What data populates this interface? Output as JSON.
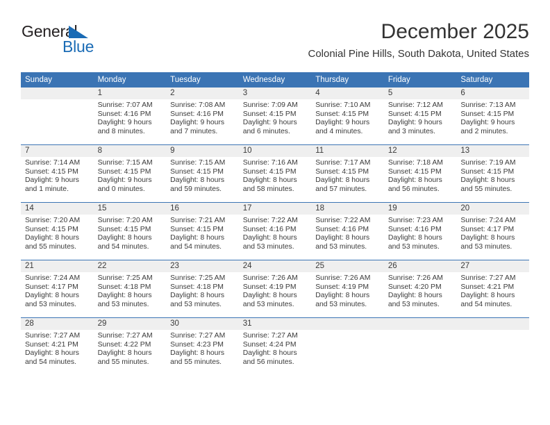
{
  "brand": {
    "name_top": "General",
    "name_bottom": "Blue",
    "accent_color": "#1a6bb5"
  },
  "header": {
    "title": "December 2025",
    "subtitle": "Colonial Pine Hills, South Dakota, United States",
    "header_bg_color": "#3b74b4",
    "daynum_bg_color": "#efefef"
  },
  "calendar": {
    "weekday_headers": [
      "Sunday",
      "Monday",
      "Tuesday",
      "Wednesday",
      "Thursday",
      "Friday",
      "Saturday"
    ],
    "weeks": [
      [
        {
          "day": "",
          "sunrise": "",
          "sunset": "",
          "daylight_line1": "",
          "daylight_line2": ""
        },
        {
          "day": "1",
          "sunrise": "Sunrise: 7:07 AM",
          "sunset": "Sunset: 4:16 PM",
          "daylight_line1": "Daylight: 9 hours",
          "daylight_line2": "and 8 minutes."
        },
        {
          "day": "2",
          "sunrise": "Sunrise: 7:08 AM",
          "sunset": "Sunset: 4:16 PM",
          "daylight_line1": "Daylight: 9 hours",
          "daylight_line2": "and 7 minutes."
        },
        {
          "day": "3",
          "sunrise": "Sunrise: 7:09 AM",
          "sunset": "Sunset: 4:15 PM",
          "daylight_line1": "Daylight: 9 hours",
          "daylight_line2": "and 6 minutes."
        },
        {
          "day": "4",
          "sunrise": "Sunrise: 7:10 AM",
          "sunset": "Sunset: 4:15 PM",
          "daylight_line1": "Daylight: 9 hours",
          "daylight_line2": "and 4 minutes."
        },
        {
          "day": "5",
          "sunrise": "Sunrise: 7:12 AM",
          "sunset": "Sunset: 4:15 PM",
          "daylight_line1": "Daylight: 9 hours",
          "daylight_line2": "and 3 minutes."
        },
        {
          "day": "6",
          "sunrise": "Sunrise: 7:13 AM",
          "sunset": "Sunset: 4:15 PM",
          "daylight_line1": "Daylight: 9 hours",
          "daylight_line2": "and 2 minutes."
        }
      ],
      [
        {
          "day": "7",
          "sunrise": "Sunrise: 7:14 AM",
          "sunset": "Sunset: 4:15 PM",
          "daylight_line1": "Daylight: 9 hours",
          "daylight_line2": "and 1 minute."
        },
        {
          "day": "8",
          "sunrise": "Sunrise: 7:15 AM",
          "sunset": "Sunset: 4:15 PM",
          "daylight_line1": "Daylight: 9 hours",
          "daylight_line2": "and 0 minutes."
        },
        {
          "day": "9",
          "sunrise": "Sunrise: 7:15 AM",
          "sunset": "Sunset: 4:15 PM",
          "daylight_line1": "Daylight: 8 hours",
          "daylight_line2": "and 59 minutes."
        },
        {
          "day": "10",
          "sunrise": "Sunrise: 7:16 AM",
          "sunset": "Sunset: 4:15 PM",
          "daylight_line1": "Daylight: 8 hours",
          "daylight_line2": "and 58 minutes."
        },
        {
          "day": "11",
          "sunrise": "Sunrise: 7:17 AM",
          "sunset": "Sunset: 4:15 PM",
          "daylight_line1": "Daylight: 8 hours",
          "daylight_line2": "and 57 minutes."
        },
        {
          "day": "12",
          "sunrise": "Sunrise: 7:18 AM",
          "sunset": "Sunset: 4:15 PM",
          "daylight_line1": "Daylight: 8 hours",
          "daylight_line2": "and 56 minutes."
        },
        {
          "day": "13",
          "sunrise": "Sunrise: 7:19 AM",
          "sunset": "Sunset: 4:15 PM",
          "daylight_line1": "Daylight: 8 hours",
          "daylight_line2": "and 55 minutes."
        }
      ],
      [
        {
          "day": "14",
          "sunrise": "Sunrise: 7:20 AM",
          "sunset": "Sunset: 4:15 PM",
          "daylight_line1": "Daylight: 8 hours",
          "daylight_line2": "and 55 minutes."
        },
        {
          "day": "15",
          "sunrise": "Sunrise: 7:20 AM",
          "sunset": "Sunset: 4:15 PM",
          "daylight_line1": "Daylight: 8 hours",
          "daylight_line2": "and 54 minutes."
        },
        {
          "day": "16",
          "sunrise": "Sunrise: 7:21 AM",
          "sunset": "Sunset: 4:15 PM",
          "daylight_line1": "Daylight: 8 hours",
          "daylight_line2": "and 54 minutes."
        },
        {
          "day": "17",
          "sunrise": "Sunrise: 7:22 AM",
          "sunset": "Sunset: 4:16 PM",
          "daylight_line1": "Daylight: 8 hours",
          "daylight_line2": "and 53 minutes."
        },
        {
          "day": "18",
          "sunrise": "Sunrise: 7:22 AM",
          "sunset": "Sunset: 4:16 PM",
          "daylight_line1": "Daylight: 8 hours",
          "daylight_line2": "and 53 minutes."
        },
        {
          "day": "19",
          "sunrise": "Sunrise: 7:23 AM",
          "sunset": "Sunset: 4:16 PM",
          "daylight_line1": "Daylight: 8 hours",
          "daylight_line2": "and 53 minutes."
        },
        {
          "day": "20",
          "sunrise": "Sunrise: 7:24 AM",
          "sunset": "Sunset: 4:17 PM",
          "daylight_line1": "Daylight: 8 hours",
          "daylight_line2": "and 53 minutes."
        }
      ],
      [
        {
          "day": "21",
          "sunrise": "Sunrise: 7:24 AM",
          "sunset": "Sunset: 4:17 PM",
          "daylight_line1": "Daylight: 8 hours",
          "daylight_line2": "and 53 minutes."
        },
        {
          "day": "22",
          "sunrise": "Sunrise: 7:25 AM",
          "sunset": "Sunset: 4:18 PM",
          "daylight_line1": "Daylight: 8 hours",
          "daylight_line2": "and 53 minutes."
        },
        {
          "day": "23",
          "sunrise": "Sunrise: 7:25 AM",
          "sunset": "Sunset: 4:18 PM",
          "daylight_line1": "Daylight: 8 hours",
          "daylight_line2": "and 53 minutes."
        },
        {
          "day": "24",
          "sunrise": "Sunrise: 7:26 AM",
          "sunset": "Sunset: 4:19 PM",
          "daylight_line1": "Daylight: 8 hours",
          "daylight_line2": "and 53 minutes."
        },
        {
          "day": "25",
          "sunrise": "Sunrise: 7:26 AM",
          "sunset": "Sunset: 4:19 PM",
          "daylight_line1": "Daylight: 8 hours",
          "daylight_line2": "and 53 minutes."
        },
        {
          "day": "26",
          "sunrise": "Sunrise: 7:26 AM",
          "sunset": "Sunset: 4:20 PM",
          "daylight_line1": "Daylight: 8 hours",
          "daylight_line2": "and 53 minutes."
        },
        {
          "day": "27",
          "sunrise": "Sunrise: 7:27 AM",
          "sunset": "Sunset: 4:21 PM",
          "daylight_line1": "Daylight: 8 hours",
          "daylight_line2": "and 54 minutes."
        }
      ],
      [
        {
          "day": "28",
          "sunrise": "Sunrise: 7:27 AM",
          "sunset": "Sunset: 4:21 PM",
          "daylight_line1": "Daylight: 8 hours",
          "daylight_line2": "and 54 minutes."
        },
        {
          "day": "29",
          "sunrise": "Sunrise: 7:27 AM",
          "sunset": "Sunset: 4:22 PM",
          "daylight_line1": "Daylight: 8 hours",
          "daylight_line2": "and 55 minutes."
        },
        {
          "day": "30",
          "sunrise": "Sunrise: 7:27 AM",
          "sunset": "Sunset: 4:23 PM",
          "daylight_line1": "Daylight: 8 hours",
          "daylight_line2": "and 55 minutes."
        },
        {
          "day": "31",
          "sunrise": "Sunrise: 7:27 AM",
          "sunset": "Sunset: 4:24 PM",
          "daylight_line1": "Daylight: 8 hours",
          "daylight_line2": "and 56 minutes."
        },
        {
          "day": "",
          "sunrise": "",
          "sunset": "",
          "daylight_line1": "",
          "daylight_line2": ""
        },
        {
          "day": "",
          "sunrise": "",
          "sunset": "",
          "daylight_line1": "",
          "daylight_line2": ""
        },
        {
          "day": "",
          "sunrise": "",
          "sunset": "",
          "daylight_line1": "",
          "daylight_line2": ""
        }
      ]
    ]
  }
}
